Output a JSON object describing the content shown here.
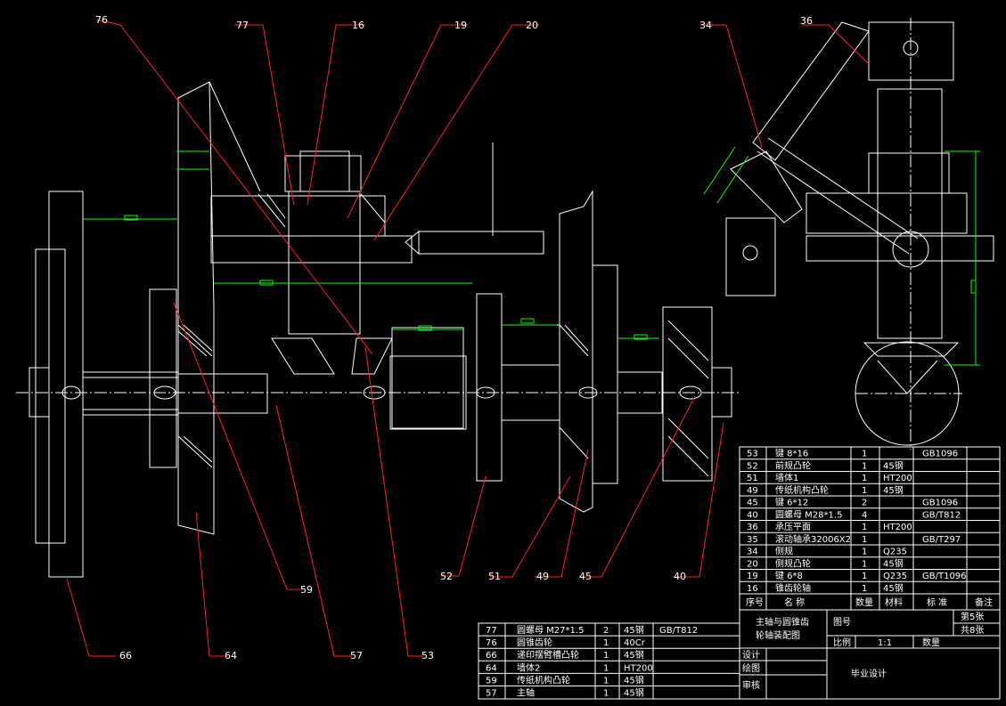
{
  "balloons": {
    "b76": "76",
    "b77": "77",
    "b16": "16",
    "b19": "19",
    "b20": "20",
    "b34": "34",
    "b36": "36",
    "b66": "66",
    "b64": "64",
    "b59": "59",
    "b57": "57",
    "b53": "53",
    "b52": "52",
    "b51": "51",
    "b49": "49",
    "b45": "45",
    "b40": "40"
  },
  "parts_upper": [
    {
      "no": "53",
      "name": "键 8*16",
      "qty": "1",
      "material": "",
      "standard": "GB1096",
      "note": ""
    },
    {
      "no": "52",
      "name": "前规凸轮",
      "qty": "1",
      "material": "45钢",
      "standard": "",
      "note": ""
    },
    {
      "no": "51",
      "name": "墙体1",
      "qty": "1",
      "material": "HT200",
      "standard": "",
      "note": ""
    },
    {
      "no": "49",
      "name": "传纸机构凸轮",
      "qty": "1",
      "material": "45钢",
      "standard": "",
      "note": ""
    },
    {
      "no": "45",
      "name": "键 6*12",
      "qty": "2",
      "material": "",
      "standard": "GB1096",
      "note": ""
    },
    {
      "no": "40",
      "name": "圆螺母 M28*1.5",
      "qty": "4",
      "material": "",
      "standard": "GB/T812",
      "note": ""
    },
    {
      "no": "36",
      "name": "承压平面",
      "qty": "1",
      "material": "HT200",
      "standard": "",
      "note": ""
    },
    {
      "no": "35",
      "name": "滚动轴承32006X2",
      "qty": "1",
      "material": "",
      "standard": "GB/T297",
      "note": ""
    },
    {
      "no": "34",
      "name": "侧规",
      "qty": "1",
      "material": "Q235",
      "standard": "",
      "note": ""
    },
    {
      "no": "20",
      "name": "侧规凸轮",
      "qty": "1",
      "material": "45钢",
      "standard": "",
      "note": ""
    },
    {
      "no": "19",
      "name": "键 6*8",
      "qty": "1",
      "material": "Q235",
      "standard": "GB/T1096",
      "note": ""
    },
    {
      "no": "16",
      "name": "锥齿轮轴",
      "qty": "1",
      "material": "45钢",
      "standard": "",
      "note": ""
    }
  ],
  "header_row": {
    "no": "序号",
    "name": "名  称",
    "qty": "数量",
    "material": "材料",
    "standard": "标  准",
    "note": "备注"
  },
  "parts_lower": [
    {
      "no": "77",
      "name": "圆螺母 M27*1.5",
      "qty": "2",
      "material": "45钢",
      "standard": "GB/T812"
    },
    {
      "no": "76",
      "name": "圆锥齿轮",
      "qty": "1",
      "material": "40Cr",
      "standard": ""
    },
    {
      "no": "66",
      "name": "递印摆臂槽凸轮",
      "qty": "1",
      "material": "45钢",
      "standard": ""
    },
    {
      "no": "64",
      "name": "墙体2",
      "qty": "1",
      "material": "HT200",
      "standard": ""
    },
    {
      "no": "59",
      "name": "传纸机构凸轮",
      "qty": "1",
      "material": "45钢",
      "standard": ""
    },
    {
      "no": "57",
      "name": "主轴",
      "qty": "1",
      "material": "45钢",
      "standard": ""
    }
  ],
  "title_block": {
    "title_line1": "主轴与圆锥齿",
    "title_line2": "轮轴装配图",
    "drawing_no_label": "图号",
    "sheet_label": "第5张",
    "total_label": "共8张",
    "scale_label": "比例",
    "scale_value": "1:1",
    "qty_label": "数量",
    "design_label": "设计",
    "draw_label": "绘图",
    "review_label": "审核",
    "project": "毕业设计"
  },
  "colors": {
    "background": "#000000",
    "outline": "#ffffff",
    "dimension": "#00ff00",
    "leader": "#ff2020"
  }
}
